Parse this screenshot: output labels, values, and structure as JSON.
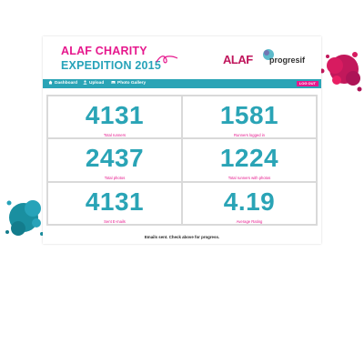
{
  "brand": {
    "line1": "ALAF CHARITY",
    "line2": "EXPEDITION 2015"
  },
  "logos": {
    "alaf": "ALAF",
    "progresif": "progresif"
  },
  "nav": {
    "items": [
      {
        "label": "Dashboard",
        "icon": "home-icon"
      },
      {
        "label": "Upload",
        "icon": "user-icon"
      },
      {
        "label": "Photo Gallery",
        "icon": "gallery-icon"
      }
    ],
    "logout_label": "LOG OUT"
  },
  "stats": [
    {
      "value": "4131",
      "label": "Total runners"
    },
    {
      "value": "1581",
      "label": "Runners logged in"
    },
    {
      "value": "2437",
      "label": "Total photos"
    },
    {
      "value": "1224",
      "label": "Total runners with photos"
    },
    {
      "value": "4131",
      "label": "Sent E-mails"
    },
    {
      "value": "4.19",
      "label": "Average Rating"
    }
  ],
  "status_text": "Emails sent. Check above for progress.",
  "colors": {
    "brand_pink": "#e6188d",
    "brand_teal": "#2aa4b6",
    "logo_red": "#c0165c"
  }
}
